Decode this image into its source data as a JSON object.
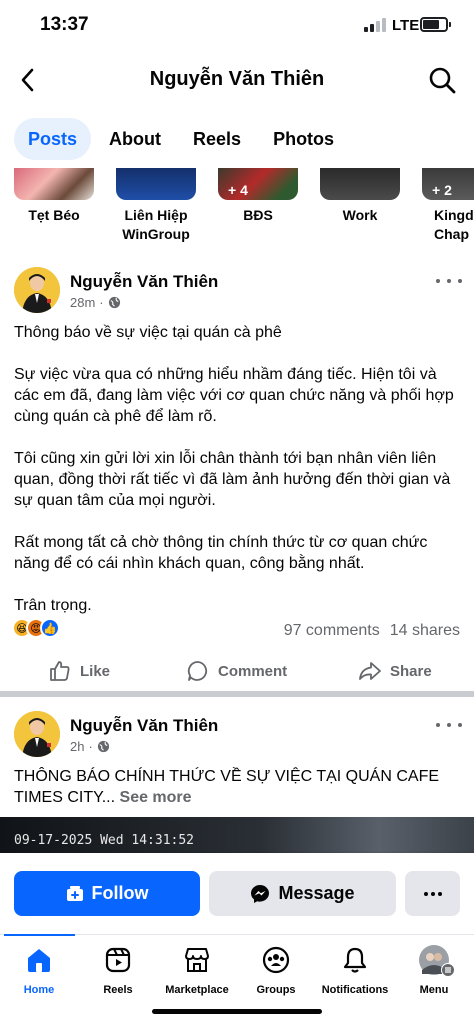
{
  "status": {
    "time": "13:37",
    "network": "LTE"
  },
  "header": {
    "title": "Nguyễn Văn Thiên"
  },
  "tabs": [
    {
      "label": "Posts"
    },
    {
      "label": "About"
    },
    {
      "label": "Reels"
    },
    {
      "label": "Photos"
    }
  ],
  "highlights": [
    {
      "label": "Tẹt Béo",
      "badge": ""
    },
    {
      "label": "Liên Hiệp\nWinGroup",
      "badge": ""
    },
    {
      "label": "BĐS",
      "badge": "+ 4"
    },
    {
      "label": "Work",
      "badge": ""
    },
    {
      "label": "Kingd\nChap",
      "badge": "+ 2"
    }
  ],
  "post1": {
    "author": "Nguyễn Văn Thiên",
    "time": "28m",
    "paragraphs": [
      "Thông báo về sự việc tại quán cà phê",
      "Sự việc vừa qua có những hiểu nhầm đáng tiếc. Hiện tôi và các em đã, đang làm việc với cơ quan chức năng và phối hợp cùng quán cà phê để làm rõ.",
      "Tôi cũng xin gửi lời xin lỗi chân thành tới bạn nhân viên liên quan, đồng thời rất tiếc vì đã làm ảnh hưởng đến thời gian và sự quan tâm của mọi người.",
      "Rất mong tất cả chờ thông tin chính thức từ cơ quan chức năng để có cái nhìn khách quan, công bằng nhất.",
      "Trân trọng."
    ],
    "comments": "97 comments",
    "shares": "14 shares",
    "actions": {
      "like": "Like",
      "comment": "Comment",
      "share": "Share"
    }
  },
  "post2": {
    "author": "Nguyễn Văn Thiên",
    "time": "2h",
    "text": "THÔNG BÁO CHÍNH THỨC VỀ SỰ VIỆC TẠI QUÁN CAFE TIMES CITY...",
    "see_more": "See more",
    "video_timestamp": "09-17-2025 Wed 14:31:52"
  },
  "buttons": {
    "follow": "Follow",
    "message": "Message"
  },
  "nav": [
    {
      "label": "Home"
    },
    {
      "label": "Reels"
    },
    {
      "label": "Marketplace"
    },
    {
      "label": "Groups"
    },
    {
      "label": "Notifications"
    },
    {
      "label": "Menu"
    }
  ],
  "colors": {
    "accent": "#0866ff",
    "tab_active_bg": "#e7f0fd",
    "secondary_text": "#65676b"
  }
}
